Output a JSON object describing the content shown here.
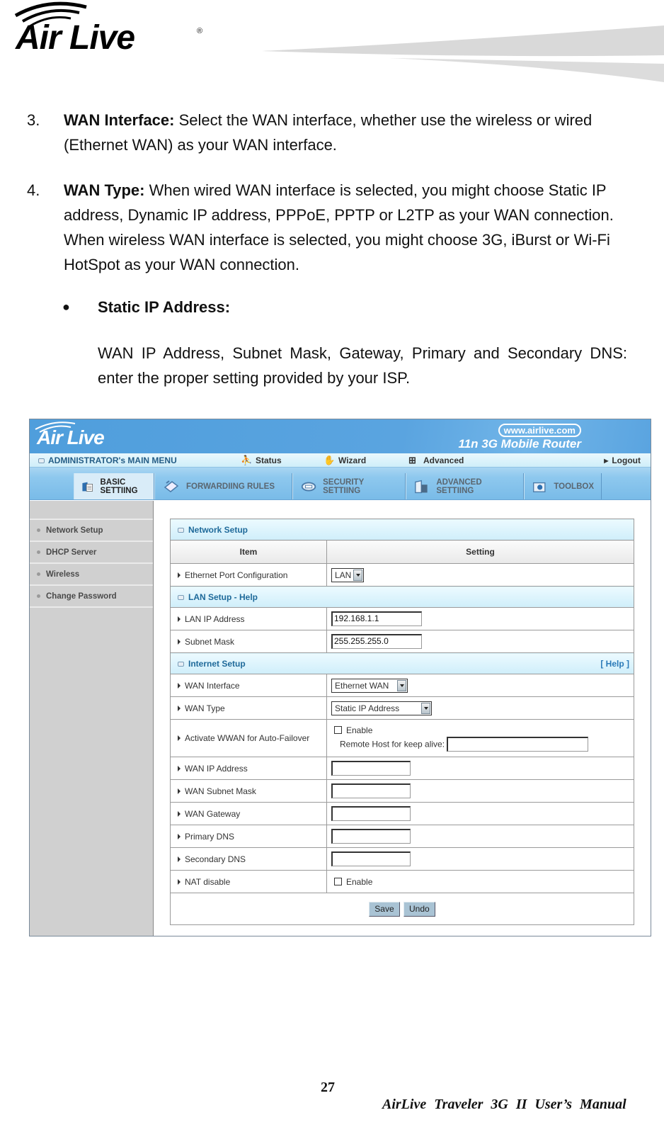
{
  "header": {
    "logo_text": "Air Live",
    "logo_reg": "®"
  },
  "sections": [
    {
      "number": "3.",
      "term": "WAN Interface:",
      "text": " Select the WAN interface, whether use the wireless or wired (Ethernet WAN) as your WAN interface."
    },
    {
      "number": "4.",
      "term": "WAN Type:",
      "text": " When wired WAN interface is selected, you might choose Static IP address, Dynamic IP address, PPPoE, PPTP or L2TP as your WAN connection. When wireless WAN interface is selected, you might choose 3G, iBurst or Wi-Fi HotSpot as your WAN connection."
    }
  ],
  "bullet": {
    "symbol": "●",
    "title": "Static IP Address:",
    "description": "WAN IP Address, Subnet Mask, Gateway, Primary and Secondary DNS: enter the proper setting provided by your ISP."
  },
  "router_ui": {
    "logo": "Air Live",
    "url": "www.airlive.com",
    "product": "11n 3G Mobile Router",
    "menubar": {
      "title": "ADMINISTRATOR's MAIN MENU",
      "status": "Status",
      "wizard": "Wizard",
      "advanced": "Advanced",
      "logout": "Logout"
    },
    "tabs": [
      {
        "label": "BASIC SETTIING",
        "active": true
      },
      {
        "label": "FORWARDIING RULES",
        "active": false
      },
      {
        "label": "SECURITY SETTIING",
        "active": false
      },
      {
        "label": "ADVANCED SETTIING",
        "active": false
      },
      {
        "label": "TOOLBOX",
        "active": false
      }
    ],
    "sidebar": [
      {
        "label": "Network Setup"
      },
      {
        "label": "DHCP Server"
      },
      {
        "label": "Wireless"
      },
      {
        "label": "Change Password"
      }
    ],
    "network_setup": {
      "title": "Network Setup",
      "col_item": "Item",
      "col_setting": "Setting",
      "ethernet_port_label": "Ethernet Port Configuration",
      "ethernet_port_value": "LAN"
    },
    "lan_setup": {
      "title": "LAN Setup - Help",
      "lan_ip_label": "LAN IP Address",
      "lan_ip_value": "192.168.1.1",
      "subnet_label": "Subnet Mask",
      "subnet_value": "255.255.255.0"
    },
    "internet_setup": {
      "title": "Internet Setup",
      "help": "[ Help ]",
      "wan_interface_label": "WAN Interface",
      "wan_interface_value": "Ethernet WAN",
      "wan_type_label": "WAN Type",
      "wan_type_value": "Static IP Address",
      "failover_label": "Activate WWAN for Auto-Failover",
      "failover_enable": "Enable",
      "failover_checked": false,
      "remote_host_label": "Remote Host for keep alive:",
      "remote_host_value": "",
      "wan_ip_label": "WAN IP Address",
      "wan_ip_value": "",
      "wan_subnet_label": "WAN Subnet Mask",
      "wan_subnet_value": "",
      "wan_gateway_label": "WAN Gateway",
      "wan_gateway_value": "",
      "primary_dns_label": "Primary DNS",
      "primary_dns_value": "",
      "secondary_dns_label": "Secondary DNS",
      "secondary_dns_value": "",
      "nat_label": "NAT disable",
      "nat_enable": "Enable",
      "nat_checked": false
    },
    "buttons": {
      "save": "Save",
      "undo": "Undo"
    }
  },
  "footer": {
    "page_number": "27",
    "manual_title": "AirLive Traveler 3G II User’s Manual"
  }
}
